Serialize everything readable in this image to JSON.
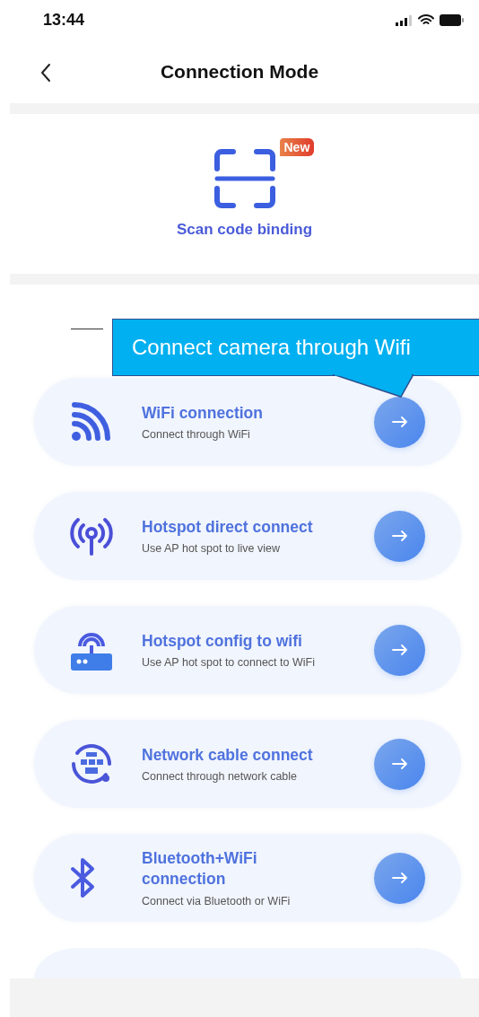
{
  "status_bar": {
    "time": "13:44"
  },
  "nav": {
    "title": "Connection Mode"
  },
  "scan": {
    "label": "Scan code binding",
    "badge": "New"
  },
  "modes": [
    {
      "kind": "wifi",
      "title": "WiFi connection",
      "subtitle": "Connect through WiFi"
    },
    {
      "kind": "hotspot",
      "title": "Hotspot direct connect",
      "subtitle": "Use AP hot spot to live view"
    },
    {
      "kind": "router",
      "title": "Hotspot config to wifi",
      "subtitle": "Use AP hot spot to connect to WiFi"
    },
    {
      "kind": "cable",
      "title": "Network cable connect",
      "subtitle": "Connect through network cable"
    },
    {
      "kind": "bluetooth",
      "title": "Bluetooth+WiFi connection",
      "subtitle": "Connect via Bluetooth or WiFi"
    }
  ],
  "callout": {
    "text": "Connect camera through Wifi"
  }
}
